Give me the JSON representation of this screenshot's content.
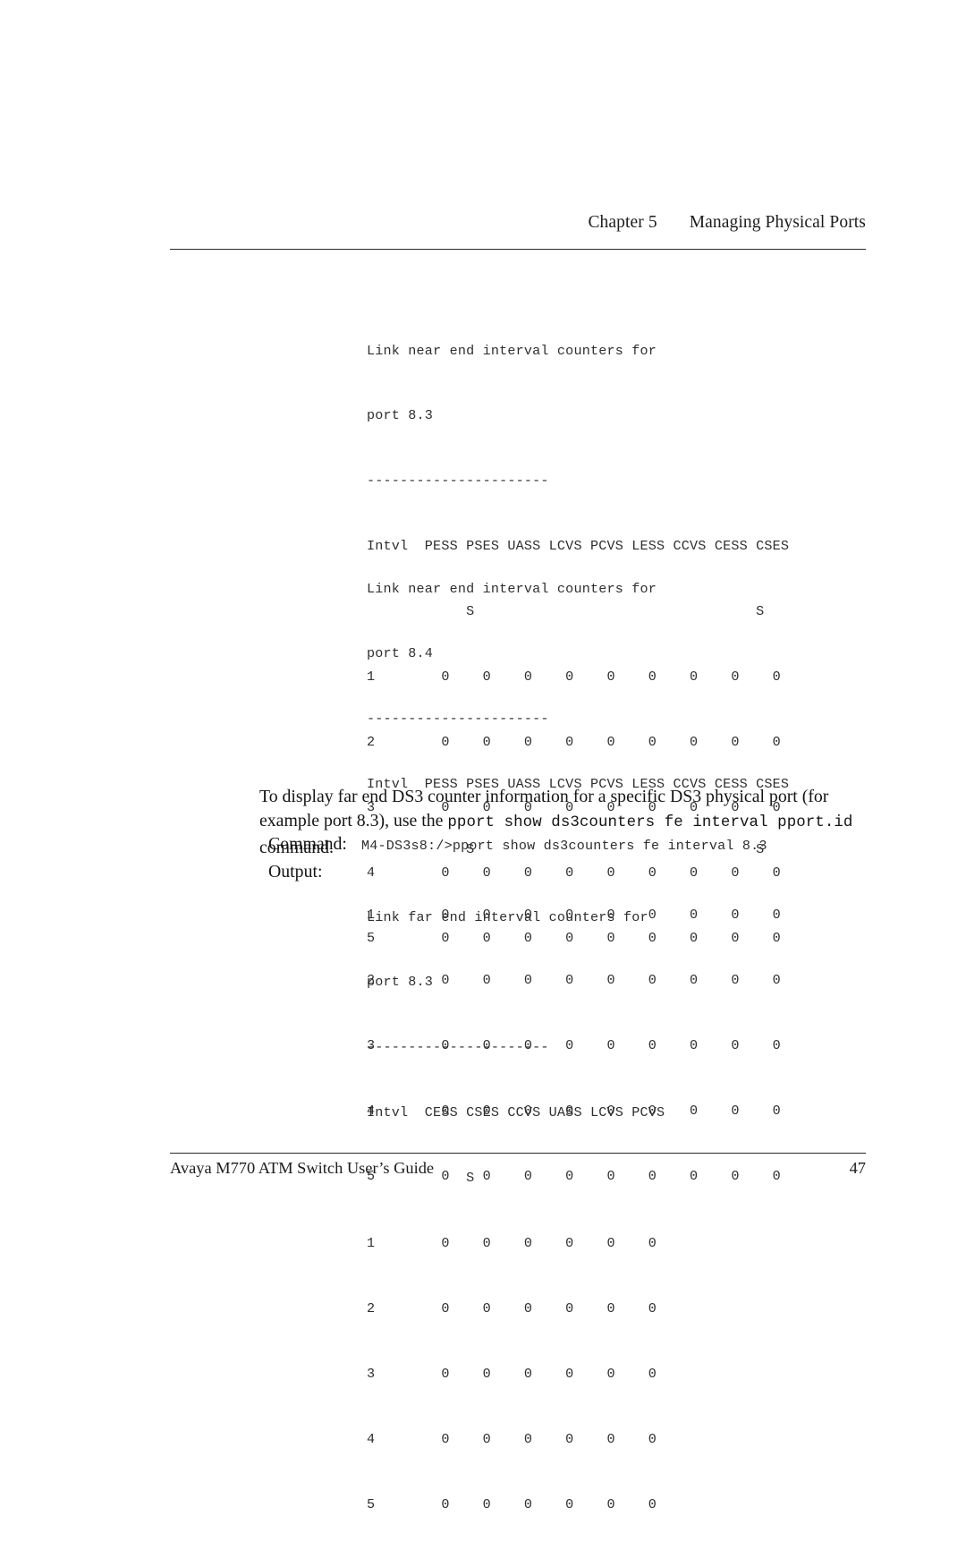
{
  "header": {
    "chapter": "Chapter 5",
    "title": "Managing Physical Ports"
  },
  "footer": {
    "guide_title": "Avaya M770 ATM Switch User’s Guide",
    "page_number": "47"
  },
  "output_block_1": {
    "line_1": "Link near end interval counters for",
    "line_2": "port 8.3",
    "separator": "----------------------",
    "header_row": "Intvl  PESS PSES UASS LCVS PCVS LESS CCVS CESS CSES",
    "header_row_cont": "            S                                  S",
    "rows": [
      "1        0    0    0    0    0    0    0    0    0",
      "2        0    0    0    0    0    0    0    0    0",
      "3        0    0    0    0    0    0    0    0    0",
      "4        0    0    0    0    0    0    0    0    0",
      "5        0    0    0    0    0    0    0    0    0"
    ],
    "columns": [
      "Intvl",
      "PESS",
      "PSESS",
      "UASS",
      "LCVS",
      "PCVS",
      "LESS",
      "CCVS",
      "CESS",
      "CSESS"
    ],
    "values": [
      [
        1,
        0,
        0,
        0,
        0,
        0,
        0,
        0,
        0,
        0
      ],
      [
        2,
        0,
        0,
        0,
        0,
        0,
        0,
        0,
        0,
        0
      ],
      [
        3,
        0,
        0,
        0,
        0,
        0,
        0,
        0,
        0,
        0
      ],
      [
        4,
        0,
        0,
        0,
        0,
        0,
        0,
        0,
        0,
        0
      ],
      [
        5,
        0,
        0,
        0,
        0,
        0,
        0,
        0,
        0,
        0
      ]
    ]
  },
  "output_block_2": {
    "line_1": "Link near end interval counters for",
    "line_2": "port 8.4",
    "separator": "----------------------",
    "header_row": "Intvl  PESS PSES UASS LCVS PCVS LESS CCVS CESS CSES",
    "header_row_cont": "            S                                  S",
    "rows": [
      "1        0    0    0    0    0    0    0    0    0",
      "2        0    0    0    0    0    0    0    0    0",
      "3        0    0    0    0    0    0    0    0    0",
      "4        0    0    0    0    0    0    0    0    0",
      "5        0    0    0    0    0    0    0    0    0"
    ],
    "columns": [
      "Intvl",
      "PESS",
      "PSESS",
      "UASS",
      "LCVS",
      "PCVS",
      "LESS",
      "CCVS",
      "CESS",
      "CSESS"
    ],
    "values": [
      [
        1,
        0,
        0,
        0,
        0,
        0,
        0,
        0,
        0,
        0
      ],
      [
        2,
        0,
        0,
        0,
        0,
        0,
        0,
        0,
        0,
        0
      ],
      [
        3,
        0,
        0,
        0,
        0,
        0,
        0,
        0,
        0,
        0
      ],
      [
        4,
        0,
        0,
        0,
        0,
        0,
        0,
        0,
        0,
        0
      ],
      [
        5,
        0,
        0,
        0,
        0,
        0,
        0,
        0,
        0,
        0
      ]
    ]
  },
  "paragraph": {
    "text_part_1": "To display far end DS3 counter information for a specific DS3 physical port (for example port 8.3), use the ",
    "command_inline": "pport show ds3counters fe interval pport.id",
    "text_part_2": " command."
  },
  "command_row": {
    "label": "Command:",
    "value": "M4-DS3s8:/>pport show ds3counters fe interval 8.3"
  },
  "output_row": {
    "label": "Output:"
  },
  "output_block_3": {
    "line_1": "Link far end interval counters for",
    "line_2": "port 8.3",
    "separator": "----------------------",
    "header_row": "Intvl  CESS CSES CCVS UASS LCVS PCVS",
    "header_row_cont": "            S",
    "rows": [
      "1        0    0    0    0    0    0",
      "2        0    0    0    0    0    0",
      "3        0    0    0    0    0    0",
      "4        0    0    0    0    0    0",
      "5        0    0    0    0    0    0"
    ],
    "columns": [
      "Intvl",
      "CESS",
      "CSESS",
      "CCVS",
      "UASS",
      "LCVS",
      "PCVS"
    ],
    "values": [
      [
        1,
        0,
        0,
        0,
        0,
        0,
        0
      ],
      [
        2,
        0,
        0,
        0,
        0,
        0,
        0
      ],
      [
        3,
        0,
        0,
        0,
        0,
        0,
        0
      ],
      [
        4,
        0,
        0,
        0,
        0,
        0,
        0
      ],
      [
        5,
        0,
        0,
        0,
        0,
        0,
        0
      ]
    ]
  }
}
